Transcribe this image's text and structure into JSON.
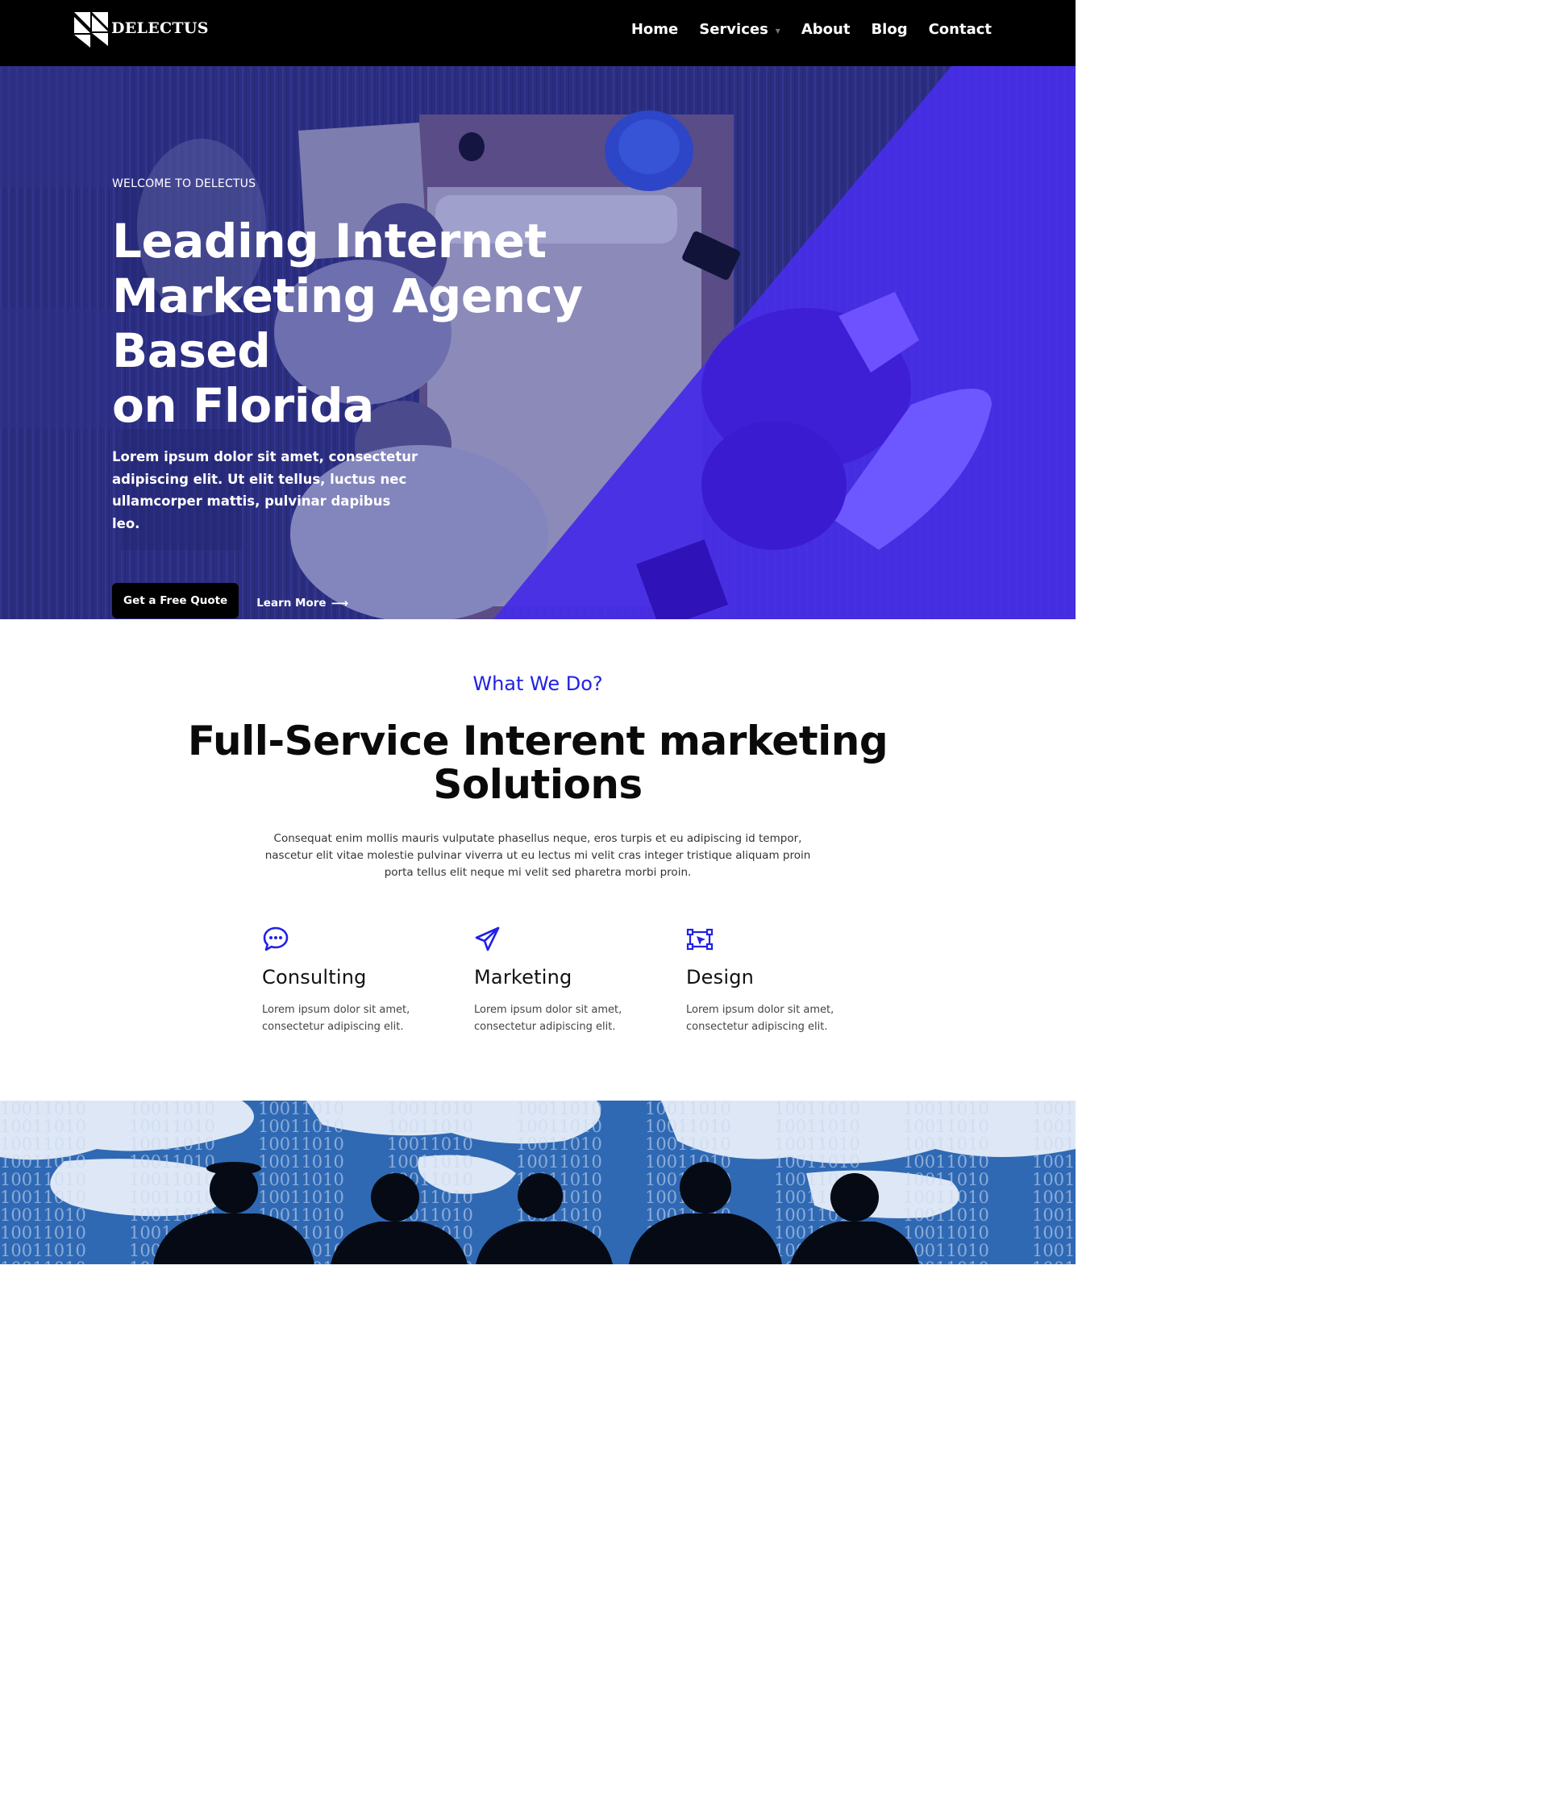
{
  "brand": {
    "name": "DELECTUS"
  },
  "nav": {
    "items": [
      {
        "label": "Home"
      },
      {
        "label": "Services",
        "caret": "▾"
      },
      {
        "label": "About"
      },
      {
        "label": "Blog"
      },
      {
        "label": "Contact"
      }
    ]
  },
  "hero": {
    "eyebrow": "WELCOME TO DELECTUS",
    "title_line1": "Leading Internet",
    "title_line2": "Marketing Agency Based",
    "title_line3": "on Florida",
    "text": "Lorem ipsum dolor sit amet, consectetur adipiscing elit. Ut elit tellus, luctus nec ullamcorper mattis, pulvinar dapibus leo.",
    "primary_button": "Get a Free Quote",
    "secondary_button": "Learn More",
    "secondary_arrow": "⟶"
  },
  "what_we_do": {
    "subtitle": "What We Do?",
    "title_line1": "Full-Service Interent marketing",
    "title_line2": "Solutions",
    "text": "Consequat enim mollis mauris vulputate phasellus neque, eros turpis et eu adipiscing id tempor, nascetur elit vitae molestie pulvinar viverra ut eu lectus mi velit cras integer tristique aliquam proin porta tellus elit neque mi velit sed pharetra morbi proin."
  },
  "services": [
    {
      "icon": "chat-bubble-icon",
      "title": "Consulting",
      "text": "Lorem ipsum dolor sit amet, consectetur adipiscing elit."
    },
    {
      "icon": "paper-plane-icon",
      "title": "Marketing",
      "text": "Lorem ipsum dolor sit amet, consectetur adipiscing elit."
    },
    {
      "icon": "vector-design-icon",
      "title": "Design",
      "text": "Lorem ipsum dolor sit amet, consectetur adipiscing elit."
    }
  ],
  "colors": {
    "header_bg": "#000000",
    "hero_overlay": "#2b2d8a",
    "accent_purple": "#4a2ef0",
    "accent_blue": "#2121e6",
    "banner_blue": "#2f69b4"
  }
}
